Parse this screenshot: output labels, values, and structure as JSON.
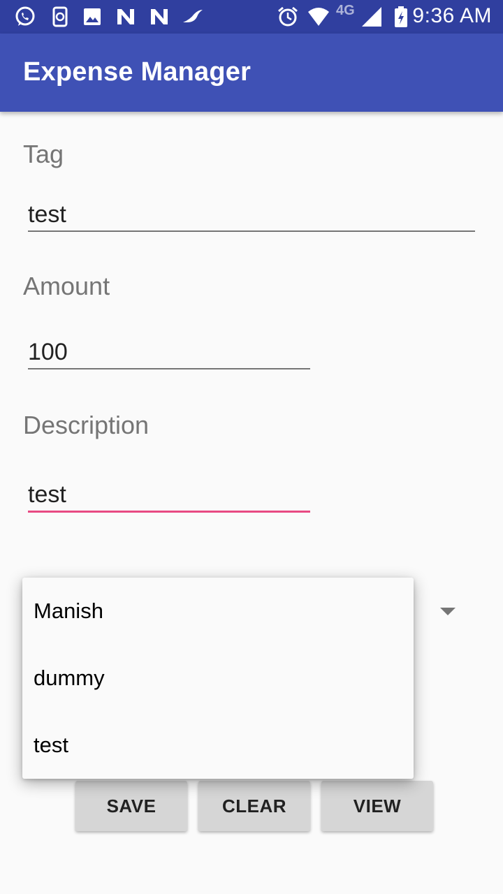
{
  "status_bar": {
    "icons": [
      "whatsapp-icon",
      "phone-sync-icon",
      "image-icon",
      "n-icon",
      "n-icon",
      "bird-icon",
      "alarm-icon",
      "wifi-icon",
      "signal-icon",
      "battery-icon"
    ],
    "network": "4G",
    "time": "9:36 AM"
  },
  "app_bar": {
    "title": "Expense Manager"
  },
  "form": {
    "tag": {
      "label": "Tag",
      "value": "test"
    },
    "amount": {
      "label": "Amount",
      "value": "100"
    },
    "description": {
      "label": "Description",
      "value": "test"
    }
  },
  "dropdown": {
    "options": [
      "Manish",
      "dummy",
      "test"
    ]
  },
  "buttons": {
    "save": "SAVE",
    "clear": "CLEAR",
    "view": "VIEW"
  },
  "colors": {
    "status_bar": "#303f9f",
    "app_bar": "#3f51b5",
    "focus_underline": "#e84a82",
    "button_bg": "#d6d6d6"
  }
}
